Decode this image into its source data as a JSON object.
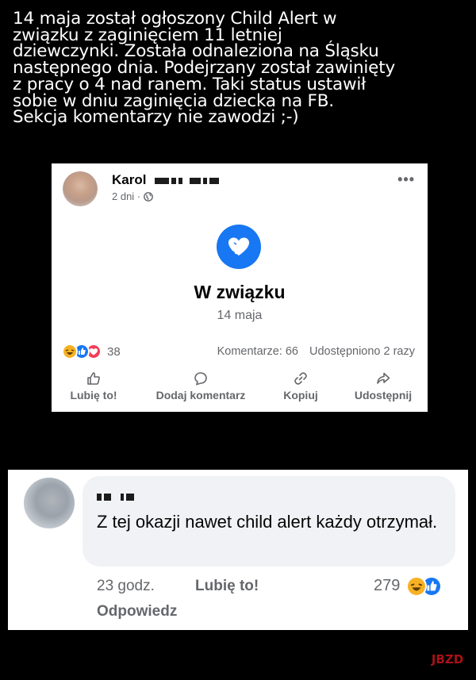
{
  "caption": {
    "lines": [
      "14 maja został ogłoszony Child Alert w",
      "związku z zaginięciem 11 letniej",
      "dziewczynki. Została odnaleziona na Śląsku",
      "następnego dnia. Podejrzany został zawinięty",
      "z pracy o 4 nad ranem. Taki status ustawił",
      "sobie w dniu zaginięcia dziecka na FB.",
      "Sekcja komentarzy nie zawodzi ;-)"
    ]
  },
  "post": {
    "author_first_name": "Karol",
    "time": "2 dni ·",
    "more": "•••",
    "life_event_title": "W związku",
    "life_event_date": "14 maja",
    "reaction_count": "38",
    "comments": "Komentarze: 66",
    "shares": "Udostępniono 2 razy",
    "actions": {
      "like": "Lubię to!",
      "comment": "Dodaj komentarz",
      "copy": "Kopiuj",
      "share": "Udostępnij"
    }
  },
  "comment": {
    "text": "Z tej okazji nawet child alert każdy otrzymał.",
    "time": "23 godz.",
    "like": "Lubię to!",
    "reply": "Odpowiedz",
    "reaction_count": "279"
  },
  "watermark": "JBZD",
  "colors": {
    "fb_blue": "#1877f2",
    "haha": "#f7b125",
    "love": "#f33e58",
    "text_secondary": "#65676b"
  }
}
